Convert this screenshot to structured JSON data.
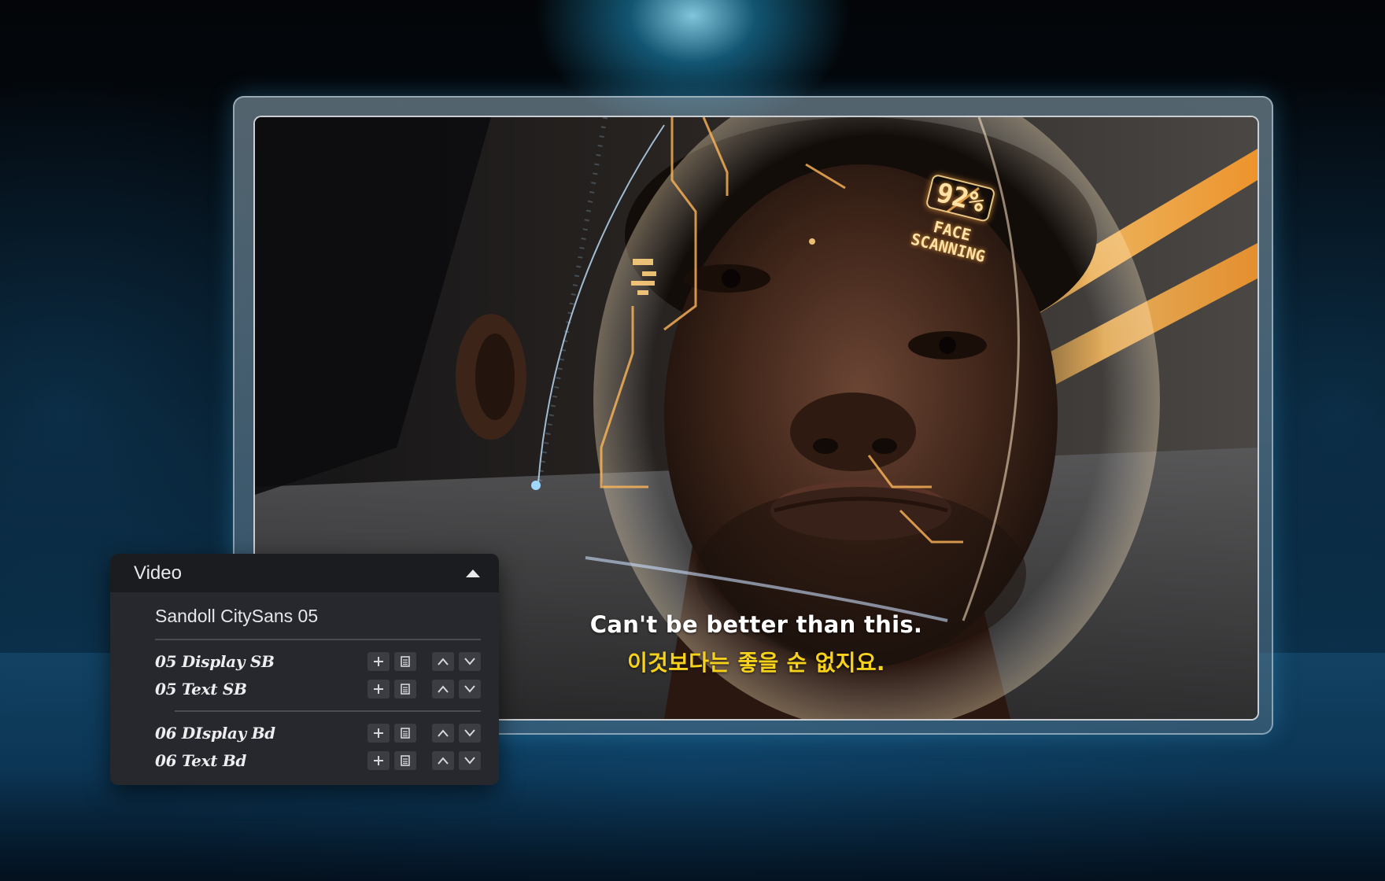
{
  "video": {
    "subtitle_en": "Can't be better than this.",
    "subtitle_ko": "이것보다는 좋을 순 없지요.",
    "scan_percent": "92%",
    "scan_label": "FACE\nSCANNING"
  },
  "panel": {
    "title": "Video",
    "collapse_icon": "chevron-up-icon",
    "family": "Sandoll CitySans 05",
    "groups": [
      {
        "rows": [
          {
            "name": "05 Display SB"
          },
          {
            "name": "05 Text SB"
          }
        ]
      },
      {
        "rows": [
          {
            "name": "06 DIsplay Bd"
          },
          {
            "name": "06 Text Bd"
          }
        ]
      }
    ],
    "row_actions": [
      "plus-icon",
      "document-icon",
      "arrow-up-icon",
      "arrow-down-icon"
    ]
  },
  "colors": {
    "subtitle_ko": "#f6d21a",
    "panel_bg": "#26282d",
    "panel_header": "#1b1c20",
    "button_bg": "#3b3d43"
  }
}
